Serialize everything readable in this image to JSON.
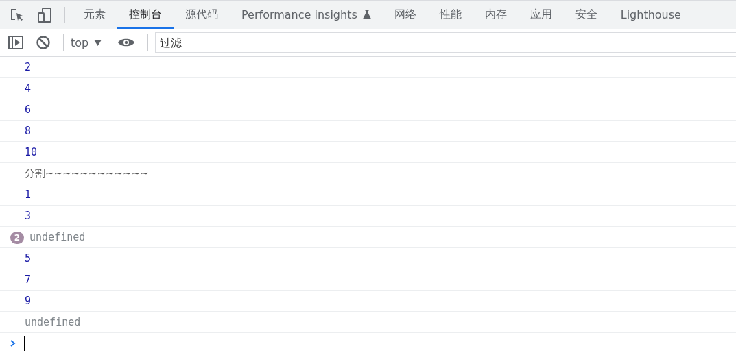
{
  "tabs": [
    {
      "label": "元素",
      "selected": false
    },
    {
      "label": "控制台",
      "selected": true
    },
    {
      "label": "源代码",
      "selected": false
    },
    {
      "label": "Performance insights",
      "selected": false,
      "experimental": true
    },
    {
      "label": "网络",
      "selected": false
    },
    {
      "label": "性能",
      "selected": false
    },
    {
      "label": "内存",
      "selected": false
    },
    {
      "label": "应用",
      "selected": false
    },
    {
      "label": "安全",
      "selected": false
    },
    {
      "label": "Lighthouse",
      "selected": false
    }
  ],
  "toolbar": {
    "context": "top",
    "filter": {
      "placeholder": "过滤"
    }
  },
  "messages": [
    {
      "kind": "number",
      "text": "2"
    },
    {
      "kind": "number",
      "text": "4"
    },
    {
      "kind": "number",
      "text": "6"
    },
    {
      "kind": "number",
      "text": "8"
    },
    {
      "kind": "number",
      "text": "10"
    },
    {
      "kind": "string",
      "text": "分割~~~~~~~~~~~~"
    },
    {
      "kind": "number",
      "text": "1"
    },
    {
      "kind": "number",
      "text": "3"
    },
    {
      "kind": "undefined",
      "text": "undefined",
      "repeat": "2"
    },
    {
      "kind": "number",
      "text": "5"
    },
    {
      "kind": "number",
      "text": "7"
    },
    {
      "kind": "number",
      "text": "9"
    },
    {
      "kind": "undefined",
      "text": "undefined"
    }
  ]
}
